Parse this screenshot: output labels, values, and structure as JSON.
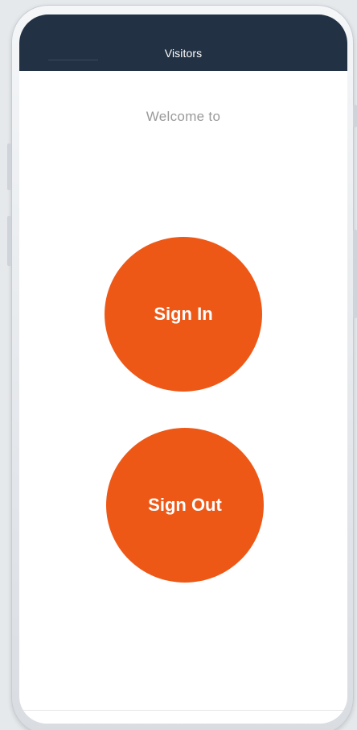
{
  "app": {
    "title": "Visitors"
  },
  "main": {
    "welcome_text": "Welcome to",
    "sign_in_label": "Sign In",
    "sign_out_label": "Sign Out"
  },
  "colors": {
    "header": "#223244",
    "accent": "#EE5817",
    "background": "#FFFFFF",
    "welcome_text": "#9A9A9A"
  }
}
